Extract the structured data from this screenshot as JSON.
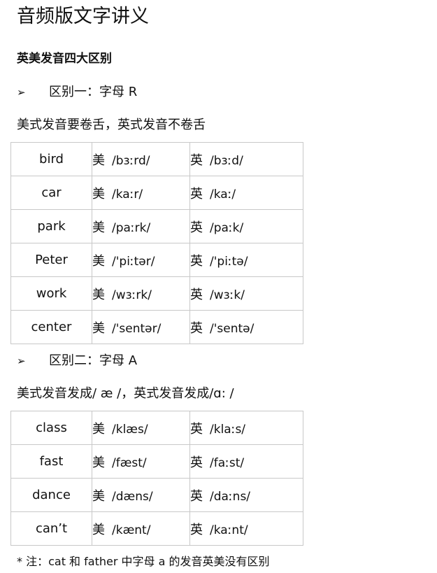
{
  "title": "音频版文字讲义",
  "subtitle": "英美发音四大区别",
  "sections": [
    {
      "bullet": "➢",
      "heading": "区别一：字母 R",
      "description": "美式发音要卷舌，英式发音不卷舌",
      "rows": [
        {
          "word": "bird",
          "us_label": "美",
          "us": "/bɜːrd/",
          "uk_label": "英",
          "uk": "/bɜːd/"
        },
        {
          "word": "car",
          "us_label": "美",
          "us": "/kaːr/",
          "uk_label": "英",
          "uk": "/kaː/"
        },
        {
          "word": "park",
          "us_label": "美",
          "us": "/paːrk/",
          "uk_label": "英",
          "uk": "/paːk/"
        },
        {
          "word": "Peter",
          "us_label": "美",
          "us": "/'piːtər/",
          "uk_label": "英",
          "uk": "/'piːtə/"
        },
        {
          "word": "work",
          "us_label": "美",
          "us": "/wɜːrk/",
          "uk_label": "英",
          "uk": "/wɜːk/"
        },
        {
          "word": "center",
          "us_label": "美",
          "us": "/'sentər/",
          "uk_label": "英",
          "uk": "/'sentə/"
        }
      ]
    },
    {
      "bullet": "➢",
      "heading": "区别二：字母 A",
      "description": "美式发音发成/ æ /，英式发音发成/ɑ: /",
      "rows": [
        {
          "word": "class",
          "us_label": "美",
          "us": "/klæs/",
          "uk_label": "英",
          "uk": "/klaːs/"
        },
        {
          "word": "fast",
          "us_label": "美",
          "us": "/fæst/",
          "uk_label": "英",
          "uk": "/faːst/"
        },
        {
          "word": "dance",
          "us_label": "美",
          "us": "/dæns/",
          "uk_label": "英",
          "uk": "/daːns/"
        },
        {
          "word": "can’t",
          "us_label": "美",
          "us": "/kænt/",
          "uk_label": "英",
          "uk": "/kaːnt/"
        }
      ]
    }
  ],
  "note": "* 注：cat 和 father 中字母 a 的发音英美没有区别"
}
